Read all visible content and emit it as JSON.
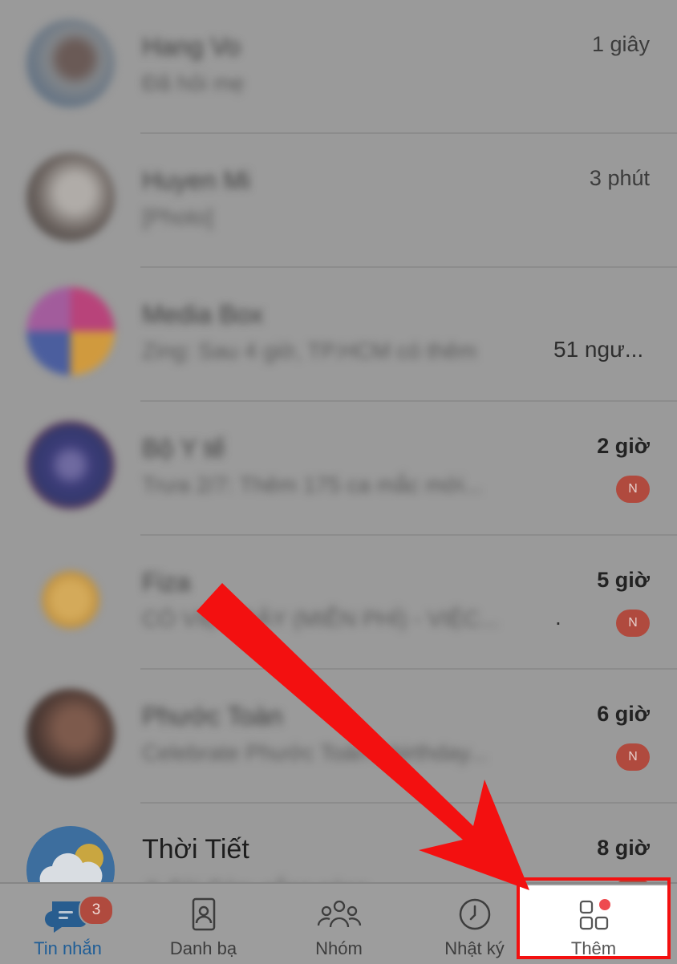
{
  "chats": [
    {
      "name": "Hang Vo",
      "preview": "Đã hỏi mẹ",
      "time": "1 giây"
    },
    {
      "name": "Huyen Mi",
      "preview": "[Photo]",
      "time": "3 phút"
    },
    {
      "name": "Media Box",
      "preview": "Zing: Sau 4 giờ, TP.HCM có thêm",
      "preview_tail": "51 ngư...",
      "time": ""
    },
    {
      "name": "Bộ Y tế",
      "preview": "Trưa 2/7: Thêm 175 ca mắc mới...",
      "time": "2 giờ",
      "badge": "N"
    },
    {
      "name": "Fiza",
      "preview": "CÓ VIỆC ĐÂY (MIỄN PHÍ) - VIỆC...",
      "preview_tail": ".",
      "time": "5 giờ",
      "badge": "N"
    },
    {
      "name": "Phước Toàn",
      "preview": "Celebrate Phước Toàn's birthday...",
      "time": "6 giờ",
      "badge": "N"
    },
    {
      "name": "Thời Tiết",
      "preview": "☀ Sài Gòn: nắng nóng...",
      "time": "8 giờ"
    }
  ],
  "tabs": {
    "messages": {
      "label": "Tin nhắn",
      "badge": "3"
    },
    "contacts": {
      "label": "Danh bạ"
    },
    "groups": {
      "label": "Nhóm"
    },
    "timeline": {
      "label": "Nhật ký"
    },
    "more": {
      "label": "Thêm"
    }
  },
  "colors": {
    "overlay": "#9a9a9a",
    "active_tab": "#1f5d96",
    "badge": "#b04a3e",
    "annotation": "#f31010"
  }
}
